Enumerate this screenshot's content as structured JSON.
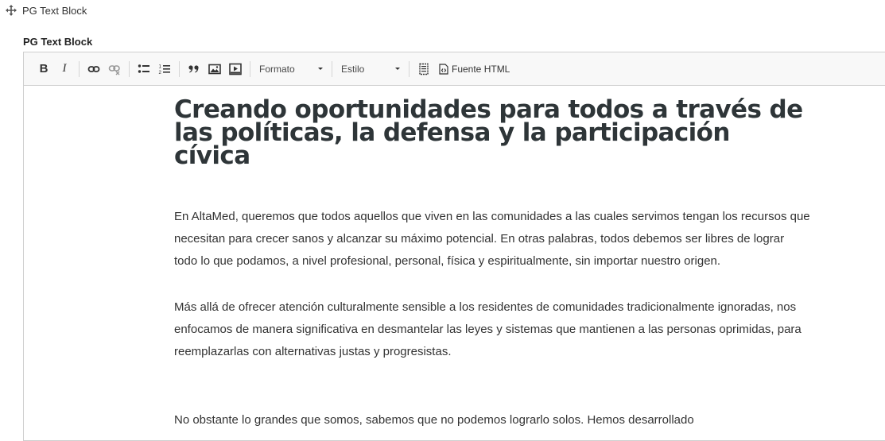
{
  "block_header": {
    "title": "PG Text Block",
    "drag_icon": "move-icon"
  },
  "field": {
    "label": "PG Text Block"
  },
  "toolbar": {
    "bold": "B",
    "italic": "I",
    "format_label": "Formato",
    "style_label": "Estilo",
    "source_label": "Fuente HTML",
    "icons": [
      "bold-icon",
      "italic-icon",
      "link-icon",
      "unlink-icon",
      "bulleted-list-icon",
      "numbered-list-icon",
      "blockquote-icon",
      "image-icon",
      "media-icon",
      "show-blocks-icon",
      "source-icon"
    ]
  },
  "content": {
    "heading": "Creando oportunidades para todos a través de las políticas, la defensa y la participación cívica",
    "paragraphs": [
      "En AltaMed, queremos que todos aquellos que viven en las comunidades a las cuales servimos tengan los recursos que necesitan para crecer sanos y alcanzar su máximo potencial. En otras palabras, todos debemos ser libres de lograr todo lo que podamos, a nivel profesional, personal, física y espiritualmente, sin importar nuestro origen.",
      "Más allá de ofrecer atención culturalmente sensible a los residentes de comunidades tradicionalmente ignoradas, nos enfocamos de manera significativa en desmantelar las leyes y sistemas que mantienen a las personas oprimidas, para reemplazarlas con alternativas justas y progresistas.",
      "No obstante lo grandes que somos, sabemos que no podemos lograrlo solos. Hemos desarrollado"
    ]
  }
}
